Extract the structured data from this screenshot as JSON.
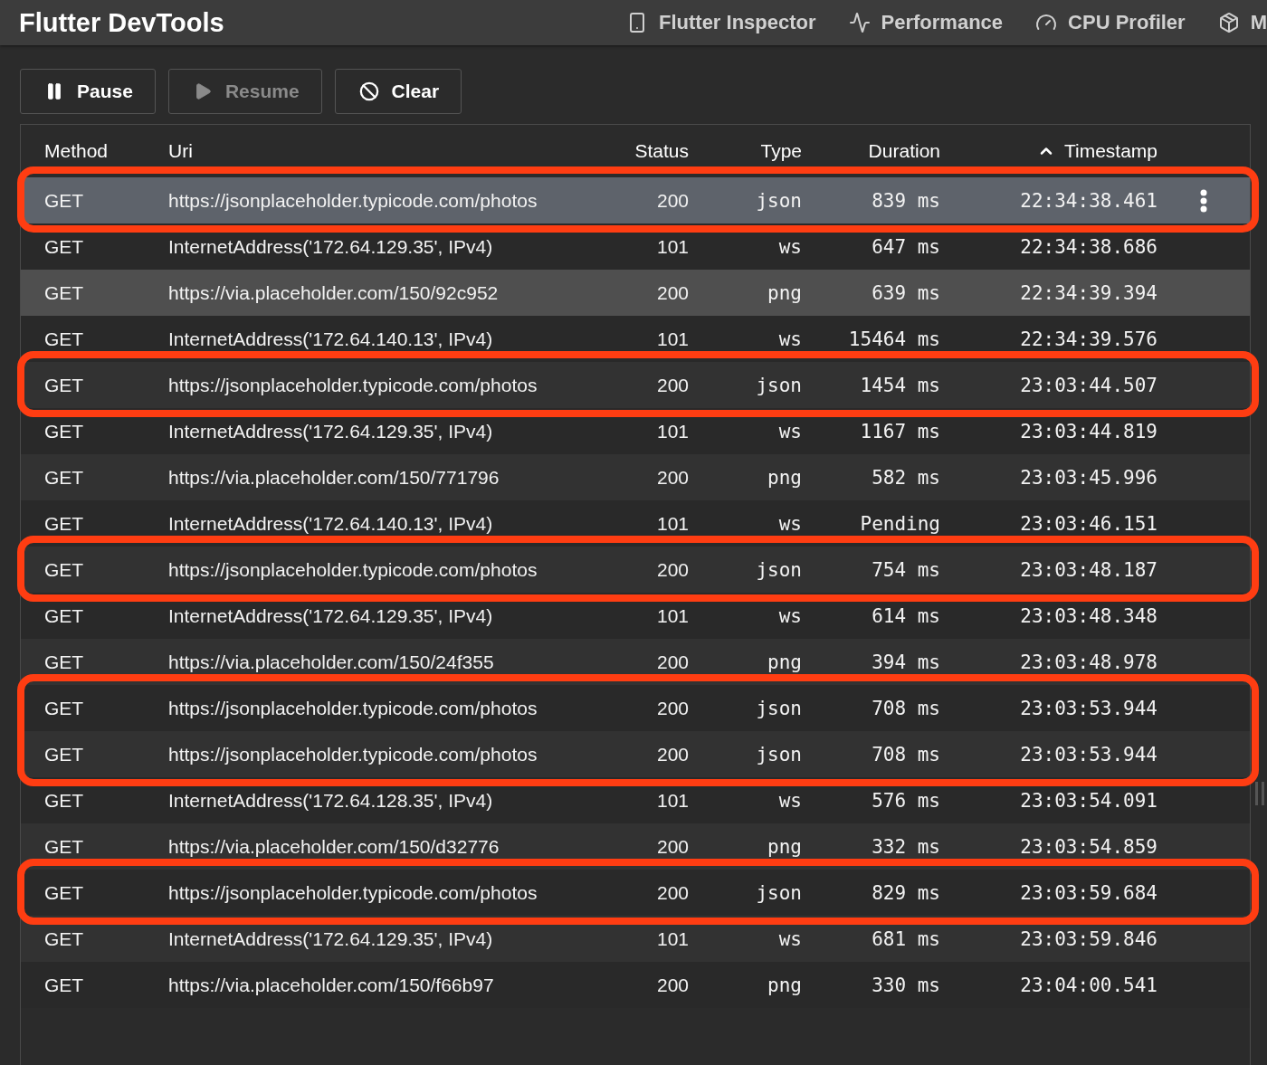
{
  "app_bar": {
    "title": "Flutter DevTools",
    "tabs": [
      {
        "label": "Flutter Inspector",
        "selected": false
      },
      {
        "label": "Performance",
        "selected": false
      },
      {
        "label": "CPU Profiler",
        "selected": false
      },
      {
        "label": "M",
        "selected": false
      }
    ]
  },
  "toolbar": [
    {
      "label": "Pause",
      "disabled": false
    },
    {
      "label": "Resume",
      "disabled": true
    },
    {
      "label": "Clear",
      "disabled": false
    }
  ],
  "table": {
    "columns": [
      {
        "label": "Method",
        "sorted": false
      },
      {
        "label": "Uri",
        "sorted": false
      },
      {
        "label": "Status",
        "sorted": false
      },
      {
        "label": "Type",
        "sorted": false
      },
      {
        "label": "Duration",
        "sorted": false
      },
      {
        "label": "Timestamp",
        "sorted": true
      }
    ],
    "row_groups": [
      {
        "outlined": true,
        "rows": [
          {
            "method": "GET",
            "uri": "https://jsonplaceholder.typicode.com/photos",
            "status": "200",
            "type": "json",
            "duration": "839 ms",
            "timestamp": "22:34:38.461",
            "selected": true,
            "hovered": false
          }
        ]
      },
      {
        "outlined": false,
        "rows": [
          {
            "method": "GET",
            "uri": "InternetAddress('172.64.129.35', IPv4)",
            "status": "101",
            "type": "ws",
            "duration": "647 ms",
            "timestamp": "22:34:38.686",
            "selected": false,
            "hovered": false
          },
          {
            "method": "GET",
            "uri": "https://via.placeholder.com/150/92c952",
            "status": "200",
            "type": "png",
            "duration": "639 ms",
            "timestamp": "22:34:39.394",
            "selected": false,
            "hovered": true
          },
          {
            "method": "GET",
            "uri": "InternetAddress('172.64.140.13', IPv4)",
            "status": "101",
            "type": "ws",
            "duration": "15464 ms",
            "timestamp": "22:34:39.576",
            "selected": false,
            "hovered": false
          }
        ]
      },
      {
        "outlined": true,
        "rows": [
          {
            "method": "GET",
            "uri": "https://jsonplaceholder.typicode.com/photos",
            "status": "200",
            "type": "json",
            "duration": "1454 ms",
            "timestamp": "23:03:44.507",
            "selected": false,
            "hovered": false
          }
        ]
      },
      {
        "outlined": false,
        "rows": [
          {
            "method": "GET",
            "uri": "InternetAddress('172.64.129.35', IPv4)",
            "status": "101",
            "type": "ws",
            "duration": "1167 ms",
            "timestamp": "23:03:44.819",
            "selected": false,
            "hovered": false
          },
          {
            "method": "GET",
            "uri": "https://via.placeholder.com/150/771796",
            "status": "200",
            "type": "png",
            "duration": "582 ms",
            "timestamp": "23:03:45.996",
            "selected": false,
            "hovered": false
          },
          {
            "method": "GET",
            "uri": "InternetAddress('172.64.140.13', IPv4)",
            "status": "101",
            "type": "ws",
            "duration": "Pending",
            "timestamp": "23:03:46.151",
            "selected": false,
            "hovered": false
          }
        ]
      },
      {
        "outlined": true,
        "rows": [
          {
            "method": "GET",
            "uri": "https://jsonplaceholder.typicode.com/photos",
            "status": "200",
            "type": "json",
            "duration": "754 ms",
            "timestamp": "23:03:48.187",
            "selected": false,
            "hovered": false
          }
        ]
      },
      {
        "outlined": false,
        "rows": [
          {
            "method": "GET",
            "uri": "InternetAddress('172.64.129.35', IPv4)",
            "status": "101",
            "type": "ws",
            "duration": "614 ms",
            "timestamp": "23:03:48.348",
            "selected": false,
            "hovered": false
          },
          {
            "method": "GET",
            "uri": "https://via.placeholder.com/150/24f355",
            "status": "200",
            "type": "png",
            "duration": "394 ms",
            "timestamp": "23:03:48.978",
            "selected": false,
            "hovered": false
          }
        ]
      },
      {
        "outlined": true,
        "rows": [
          {
            "method": "GET",
            "uri": "https://jsonplaceholder.typicode.com/photos",
            "status": "200",
            "type": "json",
            "duration": "708 ms",
            "timestamp": "23:03:53.944",
            "selected": false,
            "hovered": false
          },
          {
            "method": "GET",
            "uri": "https://jsonplaceholder.typicode.com/photos",
            "status": "200",
            "type": "json",
            "duration": "708 ms",
            "timestamp": "23:03:53.944",
            "selected": false,
            "hovered": false
          }
        ]
      },
      {
        "outlined": false,
        "rows": [
          {
            "method": "GET",
            "uri": "InternetAddress('172.64.128.35', IPv4)",
            "status": "101",
            "type": "ws",
            "duration": "576 ms",
            "timestamp": "23:03:54.091",
            "selected": false,
            "hovered": false
          },
          {
            "method": "GET",
            "uri": "https://via.placeholder.com/150/d32776",
            "status": "200",
            "type": "png",
            "duration": "332 ms",
            "timestamp": "23:03:54.859",
            "selected": false,
            "hovered": false
          }
        ]
      },
      {
        "outlined": true,
        "rows": [
          {
            "method": "GET",
            "uri": "https://jsonplaceholder.typicode.com/photos",
            "status": "200",
            "type": "json",
            "duration": "829 ms",
            "timestamp": "23:03:59.684",
            "selected": false,
            "hovered": false
          }
        ]
      },
      {
        "outlined": false,
        "rows": [
          {
            "method": "GET",
            "uri": "InternetAddress('172.64.129.35', IPv4)",
            "status": "101",
            "type": "ws",
            "duration": "681 ms",
            "timestamp": "23:03:59.846",
            "selected": false,
            "hovered": false
          },
          {
            "method": "GET",
            "uri": "https://via.placeholder.com/150/f66b97",
            "status": "200",
            "type": "png",
            "duration": "330 ms",
            "timestamp": "23:04:00.541",
            "selected": false,
            "hovered": false
          }
        ]
      }
    ]
  }
}
